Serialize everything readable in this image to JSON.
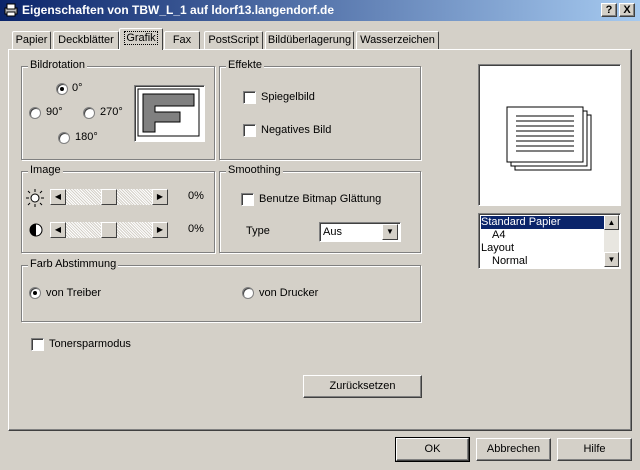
{
  "window": {
    "title": "Eigenschaften von TBW_L_1 auf ldorf13.langendorf.de",
    "help_btn": "?",
    "close_btn": "X"
  },
  "tabs": [
    {
      "label": "Papier"
    },
    {
      "label": "Deckblätter"
    },
    {
      "label": "Grafik"
    },
    {
      "label": "Fax"
    },
    {
      "label": "PostScript"
    },
    {
      "label": "Bildüberlagerung"
    },
    {
      "label": "Wasserzeichen"
    }
  ],
  "active_tab": "Grafik",
  "rotation": {
    "label": "Bildrotation",
    "opt0": "0°",
    "opt90": "90°",
    "opt270": "270°",
    "opt180": "180°",
    "selected": "0°",
    "preview_letter": "F"
  },
  "effects": {
    "label": "Effekte",
    "mirror": "Spiegelbild",
    "negative": "Negatives Bild"
  },
  "image": {
    "label": "Image",
    "brightness_value": "0%",
    "contrast_value": "0%"
  },
  "smoothing": {
    "label": "Smoothing",
    "bitmap": "Benutze Bitmap Glättung",
    "type_label": "Type",
    "type_value": "Aus"
  },
  "color": {
    "label": "Farb Abstimmung",
    "driver": "von Treiber",
    "printer": "von Drucker",
    "selected": "von Treiber"
  },
  "toner_save": "Tonersparmodus",
  "reset_btn": "Zurücksetzen",
  "summary_list": [
    "Standard Papier",
    "A4",
    "Layout",
    "Normal"
  ],
  "buttons": {
    "ok": "OK",
    "cancel": "Abbrechen",
    "help": "Hilfe"
  },
  "colors": {
    "titlebar": "#0a246a",
    "face": "#d4d0c8",
    "selection": "#0a246a"
  }
}
